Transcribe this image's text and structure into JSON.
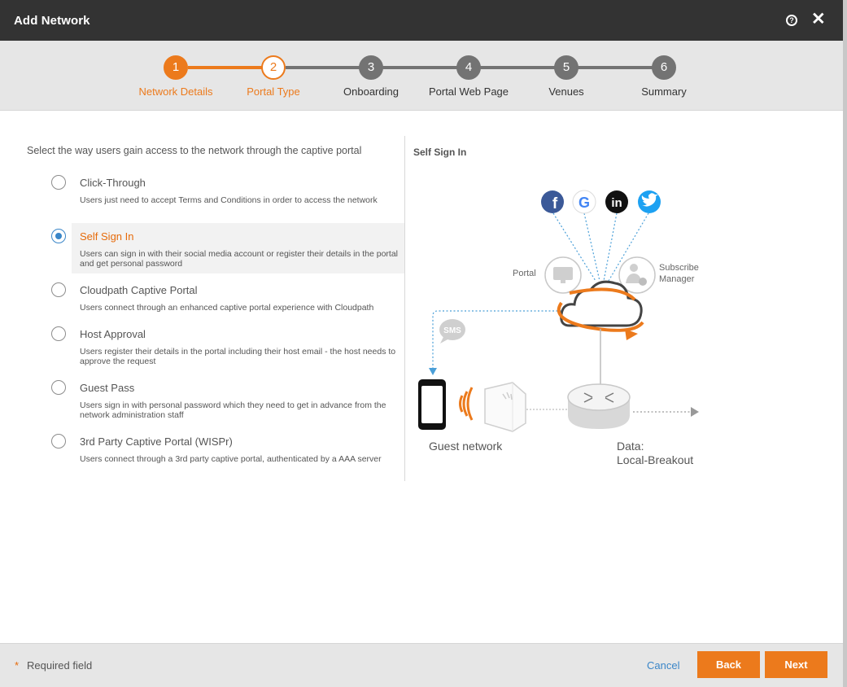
{
  "window": {
    "title": "Add Network",
    "help_icon": "?",
    "close_icon": "✕"
  },
  "stepper": {
    "steps": [
      {
        "number": "1",
        "label": "Network Details",
        "state": "done"
      },
      {
        "number": "2",
        "label": "Portal Type",
        "state": "current"
      },
      {
        "number": "3",
        "label": "Onboarding",
        "state": "todo"
      },
      {
        "number": "4",
        "label": "Portal Web Page",
        "state": "todo"
      },
      {
        "number": "5",
        "label": "Venues",
        "state": "todo"
      },
      {
        "number": "6",
        "label": "Summary",
        "state": "todo"
      }
    ],
    "colors": {
      "active": "#ec7a1c",
      "inactive": "#737373"
    }
  },
  "left": {
    "intro": "Select the way users gain access to the network through the captive portal",
    "options": [
      {
        "title": "Click-Through",
        "description": "Users just need to accept Terms and Conditions in order to access the network",
        "selected": false
      },
      {
        "title": "Self Sign In",
        "description": "Users can sign in with their social media account or register their details in the portal and get personal password",
        "selected": true
      },
      {
        "title": "Cloudpath Captive Portal",
        "description": "Users connect through an enhanced captive portal experience with Cloudpath",
        "selected": false
      },
      {
        "title": "Host Approval",
        "description": "Users register their details in the portal including their host email - the host needs to approve the request",
        "selected": false
      },
      {
        "title": "Guest Pass",
        "description": "Users sign in with personal password which they need to get in advance from the network administration staff",
        "selected": false
      },
      {
        "title": "3rd Party Captive Portal (WISPr)",
        "description": "Users connect through a 3rd party captive portal, authenticated by a AAA server",
        "selected": false
      }
    ]
  },
  "right": {
    "title": "Self Sign In",
    "diagram": {
      "portal_label": "Portal",
      "subscribe_label_1": "Subscribe",
      "subscribe_label_2": "Manager",
      "sms_label": "SMS",
      "guest_label": "Guest network",
      "data_label_1": "Data:",
      "data_label_2": "Local-Breakout",
      "social_icons": [
        "facebook-icon",
        "google-icon",
        "linkedin-icon",
        "twitter-icon"
      ]
    }
  },
  "footer": {
    "required_star": "*",
    "required_text": "Required field",
    "cancel_label": "Cancel",
    "back_label": "Back",
    "next_label": "Next"
  }
}
